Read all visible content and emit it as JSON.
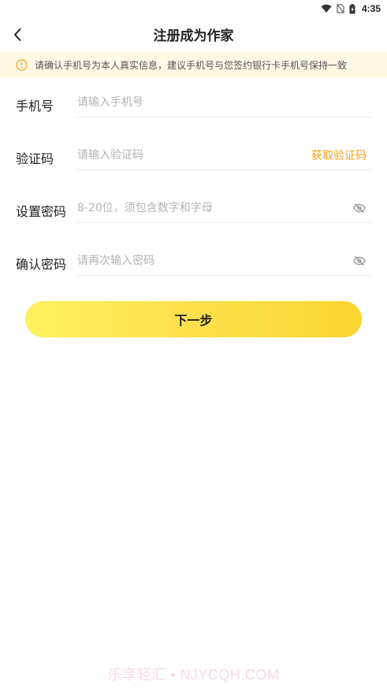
{
  "status_bar": {
    "time": "4:35",
    "icons": [
      "wifi-icon",
      "no-sim-icon",
      "battery-icon"
    ]
  },
  "header": {
    "title": "注册成为作家",
    "back_icon": "chevron-left-icon"
  },
  "notice": {
    "icon": "info-icon",
    "text": "请确认手机号为本人真实信息，建议手机号与您签约银行卡手机号保持一致",
    "bg_color": "#fff8e3",
    "icon_color": "#f0a020"
  },
  "form": {
    "phone": {
      "label": "手机号",
      "placeholder": "请输入手机号"
    },
    "code": {
      "label": "验证码",
      "placeholder": "请输入验证码",
      "get_code_label": "获取验证码"
    },
    "password": {
      "label": "设置密码",
      "placeholder": "8-20位，须包含数字和字母",
      "toggle_icon": "eye-off-icon"
    },
    "confirm_password": {
      "label": "确认密码",
      "placeholder": "请再次输入密码",
      "toggle_icon": "eye-off-icon"
    }
  },
  "next_button": {
    "label": "下一步",
    "color_start": "#fff060",
    "color_end": "#fbd530"
  },
  "accent_color": "#f0a020",
  "watermark": "乐享轻汇 • NJYCQH.COM"
}
